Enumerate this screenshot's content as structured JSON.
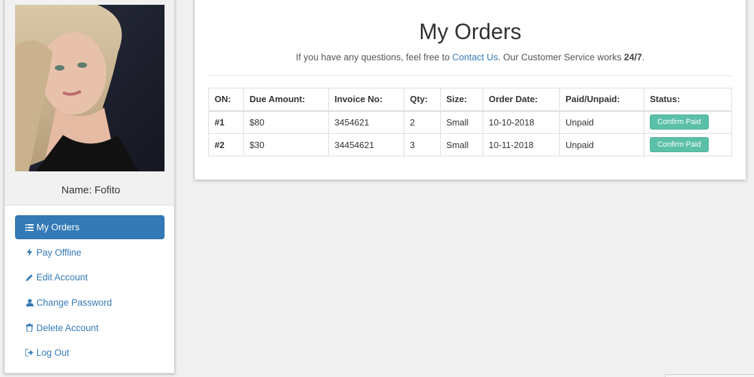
{
  "profile": {
    "name_label": "Name:",
    "name_value": "Fofito"
  },
  "nav": {
    "items": [
      {
        "label": "My Orders",
        "icon": "list-icon",
        "active": true
      },
      {
        "label": "Pay Offline",
        "icon": "bolt-icon",
        "active": false
      },
      {
        "label": "Edit Account",
        "icon": "pencil-icon",
        "active": false
      },
      {
        "label": "Change Password",
        "icon": "user-icon",
        "active": false
      },
      {
        "label": "Delete Account",
        "icon": "trash-icon",
        "active": false
      },
      {
        "label": "Log Out",
        "icon": "sign-out-icon",
        "active": false
      }
    ]
  },
  "main": {
    "title": "My Orders",
    "subtitle_prefix": "If you have any questions, feel free to",
    "contact_link": "Contact Us",
    "subtitle_mid": ". Our Customer Service works",
    "subtitle_bold": "24/7",
    "subtitle_end": "."
  },
  "orders_table": {
    "headers": [
      "ON:",
      "Due Amount:",
      "Invoice No:",
      "Qty:",
      "Size:",
      "Order Date:",
      "Paid/Unpaid:",
      "Status:"
    ],
    "rows": [
      {
        "on": "#1",
        "amount": "$80",
        "invoice": "3454621",
        "qty": "2",
        "size": "Small",
        "date": "10-10-2018",
        "paid": "Unpaid",
        "status": "Confirm Paid"
      },
      {
        "on": "#2",
        "amount": "$30",
        "invoice": "34454621",
        "qty": "3",
        "size": "Small",
        "date": "10-11-2018",
        "paid": "Unpaid",
        "status": "Confirm Paid"
      }
    ]
  },
  "colors": {
    "primary": "#337ab7",
    "confirm_button": "#5bc0a8",
    "background": "#f0f0f0"
  }
}
